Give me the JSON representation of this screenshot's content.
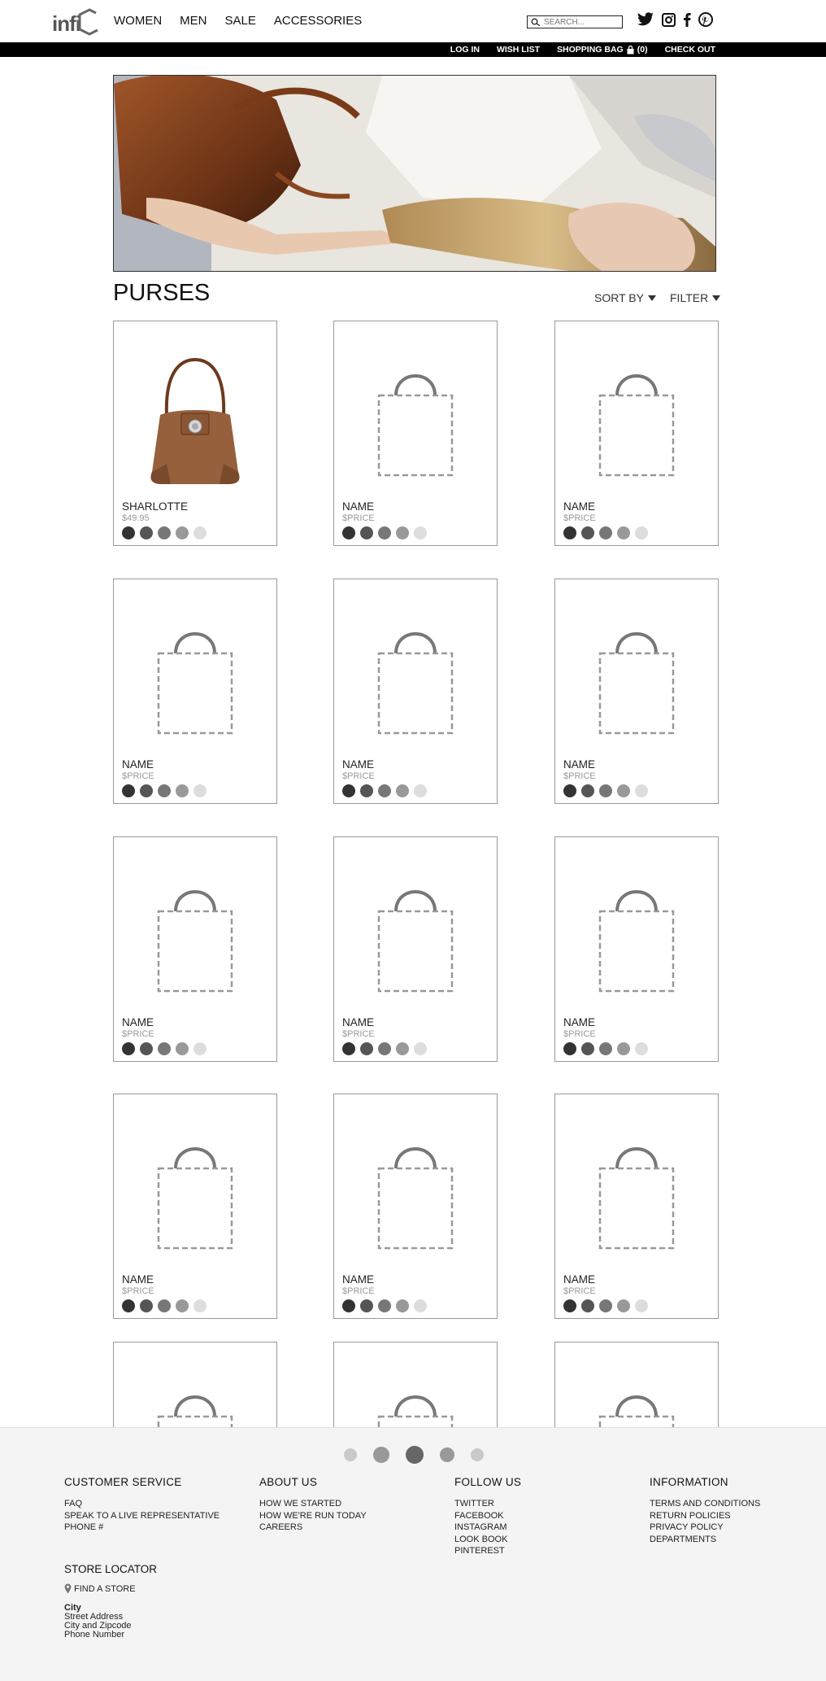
{
  "logo": {
    "text": "infi"
  },
  "nav": {
    "women": "WOMEN",
    "men": "MEN",
    "sale": "SALE",
    "accessories": "ACCESSORIES"
  },
  "search": {
    "placeholder": "SEARCH..."
  },
  "social": [
    "twitter-icon",
    "instagram-icon",
    "facebook-icon",
    "pinterest-icon"
  ],
  "utility": {
    "login": "LOG IN",
    "wishlist": "WISH LIST",
    "bag": "SHOPPING BAG",
    "bag_count": "(0)",
    "checkout": "CHECK OUT"
  },
  "page": {
    "title": "PURSES",
    "sort": "SORT BY",
    "filter": "FILTER"
  },
  "swatch_colors": [
    "#333333",
    "#555555",
    "#777777",
    "#999999",
    "#dddddd"
  ],
  "products": [
    {
      "name": "SHARLOTTE",
      "price": "$49.95"
    },
    {
      "name": "NAME",
      "price": "$PRICE"
    },
    {
      "name": "NAME",
      "price": "$PRICE"
    },
    {
      "name": "NAME",
      "price": "$PRICE"
    },
    {
      "name": "NAME",
      "price": "$PRICE"
    },
    {
      "name": "NAME",
      "price": "$PRICE"
    },
    {
      "name": "NAME",
      "price": "$PRICE"
    },
    {
      "name": "NAME",
      "price": "$PRICE"
    },
    {
      "name": "NAME",
      "price": "$PRICE"
    },
    {
      "name": "NAME",
      "price": "$PRICE"
    },
    {
      "name": "NAME",
      "price": "$PRICE"
    },
    {
      "name": "NAME",
      "price": "$PRICE"
    }
  ],
  "pagination": {
    "pages": 5,
    "current": 3
  },
  "footer": {
    "customer_service": {
      "title": "CUSTOMER SERVICE",
      "links": [
        "FAQ",
        "SPEAK TO A LIVE REPRESENTATIVE",
        "PHONE #"
      ]
    },
    "about": {
      "title": "ABOUT US",
      "links": [
        "HOW WE STARTED",
        "HOW WE'RE RUN TODAY",
        "CAREERS"
      ]
    },
    "follow": {
      "title": "FOLLOW US",
      "links": [
        "TWITTER",
        "FACEBOOK",
        "INSTAGRAM",
        "LOOK BOOK",
        "PINTEREST"
      ]
    },
    "information": {
      "title": "INFORMATION",
      "links": [
        "TERMS AND CONDITIONS",
        "RETURN POLICIES",
        "PRIVACY POLICY",
        "DEPARTMENTS"
      ]
    },
    "store": {
      "title": "STORE LOCATOR",
      "find": "FIND A STORE",
      "city": "City",
      "street": "Street Address",
      "zip": "City and Zipcode",
      "phone": "Phone Number"
    }
  }
}
